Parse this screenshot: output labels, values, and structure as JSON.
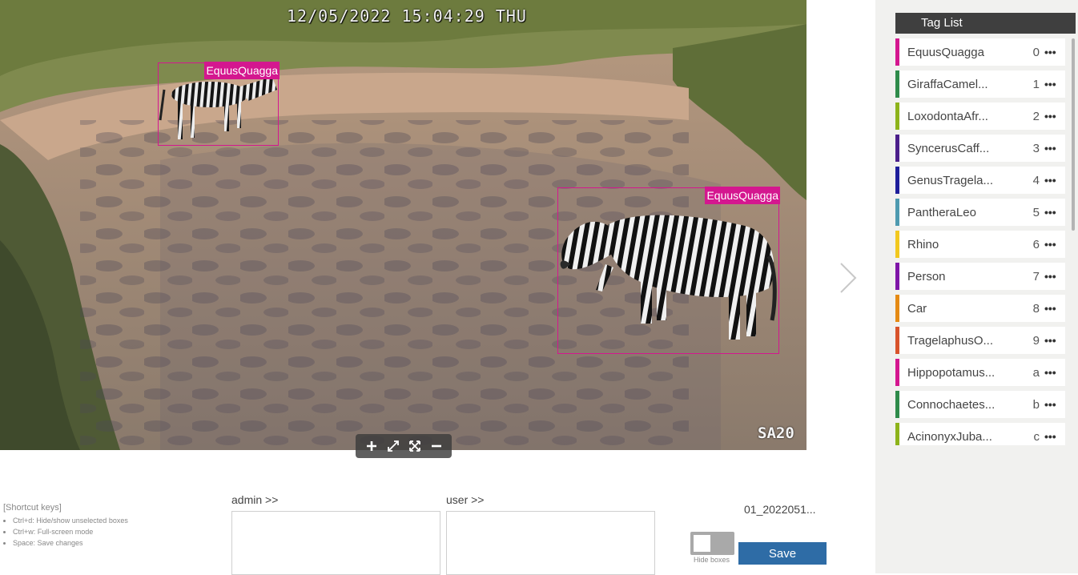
{
  "viewer": {
    "timestamp": "12/05/2022 15:04:29 THU",
    "camera_id": "SA20",
    "detections": [
      {
        "label": "EquusQuagga"
      },
      {
        "label": "EquusQuagga"
      }
    ],
    "box_color": "#d4178f"
  },
  "toolbar": {
    "zoom_in_icon": "plus-icon",
    "fit_icon": "expand-icon",
    "fullscreen_icon": "fullscreen-icon",
    "zoom_out_icon": "minus-icon"
  },
  "tag_list": {
    "title": "Tag List",
    "items": [
      {
        "name": "EquusQuagga",
        "key": "0",
        "color": "#d4178f"
      },
      {
        "name": "GiraffaCamel...",
        "key": "1",
        "color": "#2e8b4a"
      },
      {
        "name": "LoxodontaAfr...",
        "key": "2",
        "color": "#8db31a"
      },
      {
        "name": "SyncerusCaff...",
        "key": "3",
        "color": "#4b1f8a"
      },
      {
        "name": "GenusTragela...",
        "key": "4",
        "color": "#1e1e9a"
      },
      {
        "name": "PantheraLeo",
        "key": "5",
        "color": "#4e9ab0"
      },
      {
        "name": "Rhino",
        "key": "6",
        "color": "#f2c81e"
      },
      {
        "name": "Person",
        "key": "7",
        "color": "#7f16a8"
      },
      {
        "name": "Car",
        "key": "8",
        "color": "#e58a14"
      },
      {
        "name": "TragelaphusO...",
        "key": "9",
        "color": "#d8532b"
      },
      {
        "name": "Hippopotamus...",
        "key": "a",
        "color": "#d4178f"
      },
      {
        "name": "Connochaetes...",
        "key": "b",
        "color": "#2e8b4a"
      },
      {
        "name": "AcinonyxJuba...",
        "key": "c",
        "color": "#8db31a"
      }
    ]
  },
  "shortcuts": {
    "title": "[Shortcut keys]",
    "items": [
      "Ctrl+d: Hide/show unselected boxes",
      "Ctrl+w: Full-screen mode",
      "Space: Save changes"
    ]
  },
  "notes": {
    "admin_label": "admin >>",
    "admin_value": "",
    "user_label": "user >>",
    "user_value": ""
  },
  "file": {
    "name": "01_2022051..."
  },
  "hide_boxes": {
    "label": "Hide boxes",
    "enabled": false
  },
  "save": {
    "label": "Save"
  }
}
